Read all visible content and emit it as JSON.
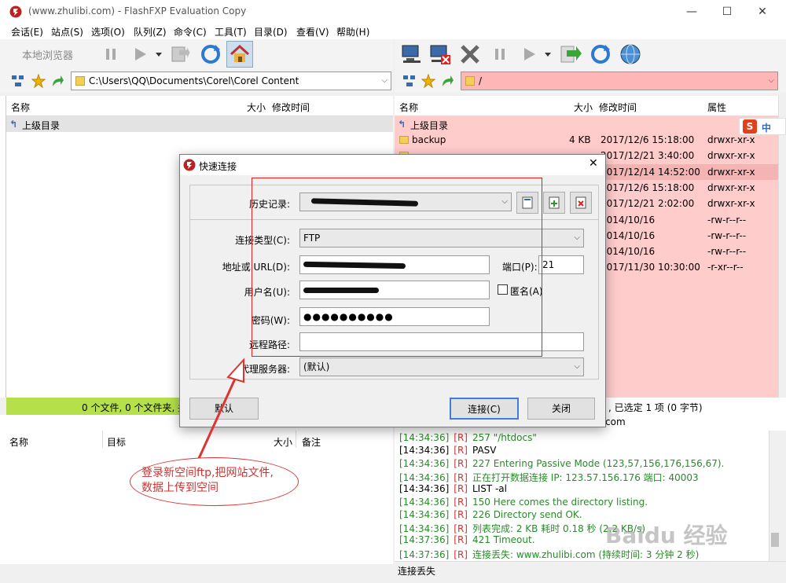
{
  "window": {
    "title": "(www.zhulibi.com) - FlashFXP Evaluation Copy",
    "controls": [
      "—",
      "☐",
      "✕"
    ]
  },
  "menu": [
    "会话(E)",
    "站点(S)",
    "选项(O)",
    "队列(Z)",
    "命令(C)",
    "工具(T)",
    "目录(D)",
    "查看(V)",
    "帮助(H)"
  ],
  "local": {
    "browse_label": "本地浏览器",
    "path": "C:\\Users\\QQ\\Documents\\Corel\\Corel Content",
    "columns": [
      "名称",
      "大小",
      "修改时间"
    ],
    "parent_label": "上级目录",
    "status": "0 个文件, 0 个文件夹, 共"
  },
  "remote": {
    "path": "/",
    "columns": [
      "名称",
      "大小",
      "修改时间",
      "属性"
    ],
    "parent_label": "上级目录",
    "rows": [
      {
        "name": "backup",
        "size": "4 KB",
        "time": "2017/12/6 15:18:00",
        "attr": "drwxr-xr-x"
      },
      {
        "name": "",
        "size": "",
        "time": "2017/12/21 3:40:00",
        "attr": "drwxr-xr-x"
      },
      {
        "name": "",
        "size": "",
        "time": "2017/12/14 14:52:00",
        "attr": "drwxr-xr-x"
      },
      {
        "name": "",
        "size": "",
        "time": "2017/12/6 15:18:00",
        "attr": "drwxr-xr-x"
      },
      {
        "name": "",
        "size": "",
        "time": "2017/12/21 2:02:00",
        "attr": "drwxr-xr-x"
      },
      {
        "name": "",
        "size": "",
        "time": "2014/10/16",
        "attr": "-rw-r--r--"
      },
      {
        "name": "",
        "size": "",
        "time": "2014/10/16",
        "attr": "-rw-r--r--"
      },
      {
        "name": "",
        "size": "",
        "time": "2014/10/16",
        "attr": "-rw-r--r--"
      },
      {
        "name": "",
        "size": "",
        "time": "2017/11/30 10:30:00",
        "attr": "-r-xr--r--"
      }
    ],
    "status": ", 已选定 1 项 (0 字节)",
    "status2": "com"
  },
  "queue": {
    "columns": [
      "名称",
      "目标",
      "大小",
      "备注"
    ]
  },
  "log": [
    {
      "t": "[14:34:36]",
      "tag": "[R]",
      "msg": "257 \"/htdocs\"",
      "color": "#2a8a2a"
    },
    {
      "t": "[14:34:36]",
      "tag": "[R]",
      "msg": "PASV",
      "color": "#000000"
    },
    {
      "t": "[14:34:36]",
      "tag": "[R]",
      "msg": "227 Entering Passive Mode (123,57,156,176,156,67).",
      "color": "#2a8a2a"
    },
    {
      "t": "[14:34:36]",
      "tag": "[R]",
      "msg": "正在打开数据连接 IP: 123.57.156.176 端口: 40003",
      "color": "#2a8a2a"
    },
    {
      "t": "[14:34:36]",
      "tag": "[R]",
      "msg": "LIST -al",
      "color": "#000000"
    },
    {
      "t": "[14:34:36]",
      "tag": "[R]",
      "msg": "150 Here comes the directory listing.",
      "color": "#2a8a2a"
    },
    {
      "t": "[14:34:36]",
      "tag": "[R]",
      "msg": "226 Directory send OK.",
      "color": "#2a8a2a"
    },
    {
      "t": "[14:34:36]",
      "tag": "[R]",
      "msg": "列表完成: 2 KB 耗时 0.18 秒 (2.2 KB/s)",
      "color": "#2a8a2a"
    },
    {
      "t": "[14:37:36]",
      "tag": "[R]",
      "msg": "421 Timeout.",
      "color": "#2a8a2a"
    },
    {
      "t": "[14:37:36]",
      "tag": "[R]",
      "msg": "连接丢失: www.zhulibi.com (持续时间: 3 分钟 2 秒)",
      "color": "#2a8a2a"
    }
  ],
  "bottom_status": "连接丢失",
  "ime": {
    "s": "S",
    "zh": "中"
  },
  "dialog": {
    "title": "快速连接",
    "history_label": "历史记录:",
    "conn_type_label": "连接类型(C):",
    "conn_type_value": "FTP",
    "url_label": "地址或 URL(D):",
    "port_label": "端口(P):",
    "port_value": "21",
    "user_label": "用户名(U):",
    "anon_label": "匿名(A)",
    "pass_label": "密码(W):",
    "pass_value": "●●●●●●●●●●",
    "remote_path_label": "远程路径:",
    "proxy_label": "代理服务器:",
    "proxy_value": "(默认)",
    "default_btn": "默认",
    "connect_btn": "连接(C)",
    "close_btn": "关闭"
  },
  "annotation": {
    "line1": "登录新空间ftp,把网站文件,",
    "line2": "数据上传到空间"
  },
  "watermark": "Baidu 经验"
}
